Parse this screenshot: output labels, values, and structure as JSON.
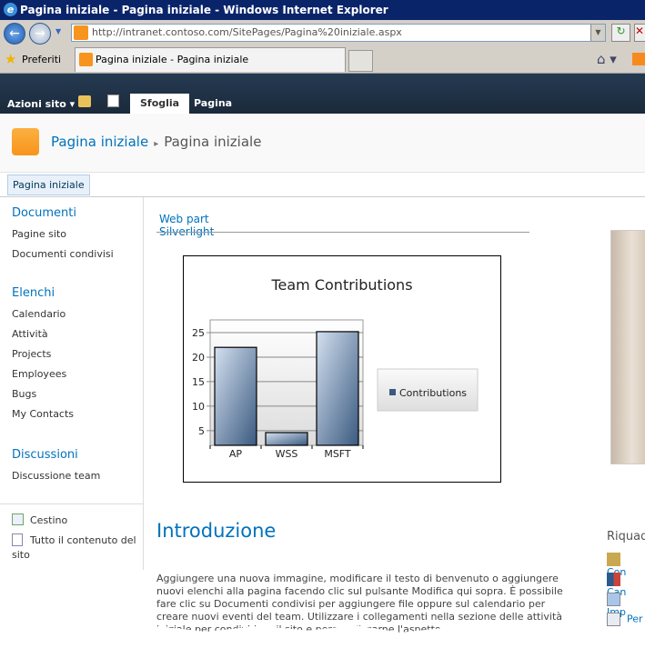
{
  "window": {
    "title": "Pagina iniziale - Pagina iniziale - Windows Internet Explorer"
  },
  "browser": {
    "url": "http://intranet.contoso.com/SitePages/Pagina%20iniziale.aspx",
    "favorites_label": "Preferiti",
    "tab_title": "Pagina iniziale - Pagina iniziale"
  },
  "ribbon": {
    "site_actions": "Azioni sito ▾",
    "tabs": [
      "Sfoglia",
      "Pagina"
    ]
  },
  "header": {
    "site": "Pagina iniziale",
    "separator": "▸",
    "page": "Pagina iniziale"
  },
  "topnav": {
    "items": [
      "Pagina iniziale"
    ]
  },
  "sidebar": {
    "sections": [
      {
        "heading": "Documenti",
        "items": [
          "Pagine sito",
          "Documenti condivisi"
        ]
      },
      {
        "heading": "Elenchi",
        "items": [
          "Calendario",
          "Attività",
          "Projects",
          "Employees",
          "Bugs",
          "My Contacts"
        ]
      },
      {
        "heading": "Discussioni",
        "items": [
          "Discussione team"
        ]
      }
    ],
    "recycle_bin": "Cestino",
    "all_content": "Tutto il contenuto del sito"
  },
  "main": {
    "webpart_title": "Web part Silverlight",
    "intro_heading": "Introduzione",
    "intro_text": "Aggiungere una nuova immagine, modificare il testo di benvenuto o aggiungere nuovi elenchi alla pagina facendo clic sul pulsante Modifica qui sopra. È possibile fare clic su Documenti condivisi per aggiungere file oppure sul calendario per creare nuovi eventi del team. Utilizzare i collegamenti nella sezione delle attività iniziale per condividere il sito e personalizzarne l'aspetto."
  },
  "right": {
    "heading": "Riquad",
    "links": [
      "Con",
      "Can",
      "Imp",
      "Per"
    ]
  },
  "chart_data": {
    "type": "bar",
    "title": "Team Contributions",
    "categories": [
      "AP",
      "WSS",
      "MSFT"
    ],
    "series": [
      {
        "name": "Contributions",
        "values": [
          22,
          4.6,
          25.2
        ]
      }
    ],
    "yticks": [
      5,
      10,
      15,
      20,
      25
    ],
    "ylim": [
      2,
      27.6
    ],
    "grid": true,
    "legend": "right",
    "color": "#3a5a80"
  }
}
